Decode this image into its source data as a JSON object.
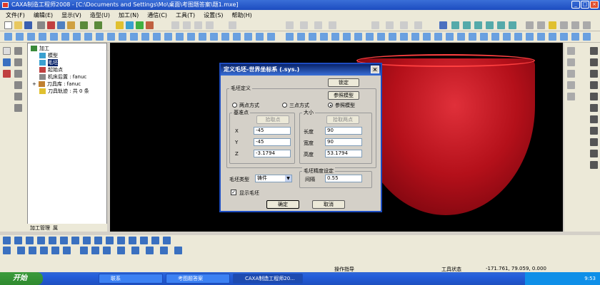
{
  "window": {
    "title": "CAXA制造工程师2008 - [C:\\Documents and Settings\\Mo\\桌面\\考图题答案\\题1.mxe]",
    "minimize": "_",
    "maximize": "□",
    "close": "×"
  },
  "menu": [
    "文件(F)",
    "编辑(E)",
    "显示(V)",
    "造型(U)",
    "加工(N)",
    "通信(C)",
    "工具(T)",
    "设置(S)",
    "帮助(H)"
  ],
  "tree": {
    "items": [
      {
        "label": "加工",
        "icon": "machining-icon"
      },
      {
        "label": "模型",
        "icon": "model-icon"
      },
      {
        "label": "毛坯",
        "icon": "blank-icon"
      },
      {
        "label": "起始点",
        "icon": "start-point-icon"
      },
      {
        "label": "机床后置 : fanuc",
        "icon": "machine-post-icon"
      },
      {
        "label": "刀具库 : fanuc",
        "icon": "tool-library-icon"
      },
      {
        "label": "刀具轨迹 : 共 0 条",
        "icon": "toolpath-icon"
      }
    ],
    "tabs": [
      "加工管理",
      "属"
    ]
  },
  "dialog": {
    "title": "定义毛坯-世界坐标系 (.sys.)",
    "lock_label": "锁定",
    "blank_def_label": "毛坯定义",
    "ref_model_button": "参照模型",
    "radio_two_point": "两点方式",
    "radio_three_point": "三点方式",
    "radio_ref_model": "参照模型",
    "base_point_label": "基准点",
    "pick_point_button": "拾取点",
    "x_label": "X",
    "x_value": "-45",
    "y_label": "Y",
    "y_value": "-45",
    "z_label": "Z",
    "z_value": "-3.1794",
    "size_label": "大小",
    "pick_two_points_button": "拾取两点",
    "length_label": "长度",
    "length_value": "90",
    "width_label": "宽度",
    "width_value": "90",
    "height_label": "高度",
    "height_value": "53.1794",
    "blank_type_label": "毛坯类型",
    "blank_type_value": "铸件",
    "precision_label": "毛坯精度设定",
    "gap_label": "间隔",
    "gap_value": "0.55",
    "show_blank_label": "显示毛坯",
    "ok_button": "确定",
    "cancel_button": "取消"
  },
  "status": {
    "hint": "操作指导",
    "state": "工具状态",
    "coords": "-171.761, 79.059, 0.000"
  },
  "taskbar": {
    "start": "开始",
    "items": [
      "联系",
      "考图题答案",
      "CAXA制造工程师20..."
    ],
    "clock": "9:53"
  }
}
